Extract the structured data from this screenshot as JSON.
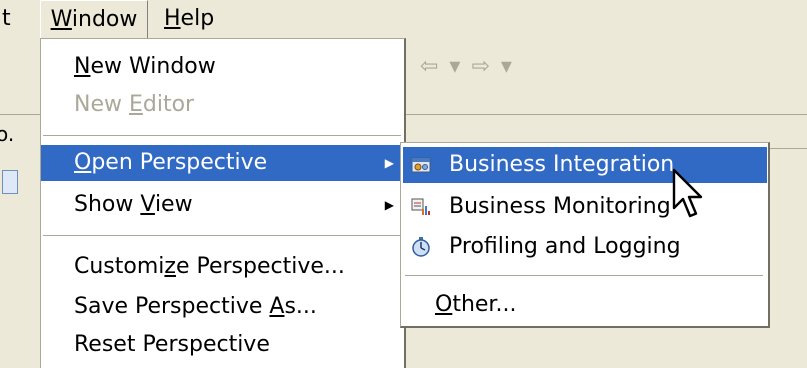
{
  "menubar": {
    "partial": "t",
    "window": {
      "mn": "W",
      "rest": "indow"
    },
    "help": {
      "mn": "H",
      "rest": "elp"
    }
  },
  "background": {
    "nav_glyphs": "⇦ ▾ ⇨ ▾",
    "panel_tab": "o."
  },
  "window_menu": {
    "new_window": {
      "mn": "N",
      "rest": "ew Window"
    },
    "new_editor": {
      "pre": "New ",
      "mn": "E",
      "rest": "ditor"
    },
    "open_perspective": {
      "mn": "O",
      "rest": "pen Perspective"
    },
    "show_view": {
      "pre": "Show ",
      "mn": "V",
      "rest": "iew"
    },
    "customize": {
      "pre": "Customi",
      "mn": "z",
      "rest": "e Perspective..."
    },
    "save_as": {
      "pre": "Save Perspective ",
      "mn": "A",
      "rest": "s..."
    },
    "reset": "Reset Perspective"
  },
  "submenu": {
    "business_integration": "Business Integration",
    "business_monitoring": "Business Monitoring",
    "profiling_logging": "Profiling and Logging",
    "other": {
      "mn": "O",
      "rest": "ther..."
    }
  },
  "colors": {
    "selection": "#316ac5",
    "menu_bg": "#ffffff",
    "chrome_bg": "#ece9d8",
    "disabled_text": "#aca899"
  }
}
